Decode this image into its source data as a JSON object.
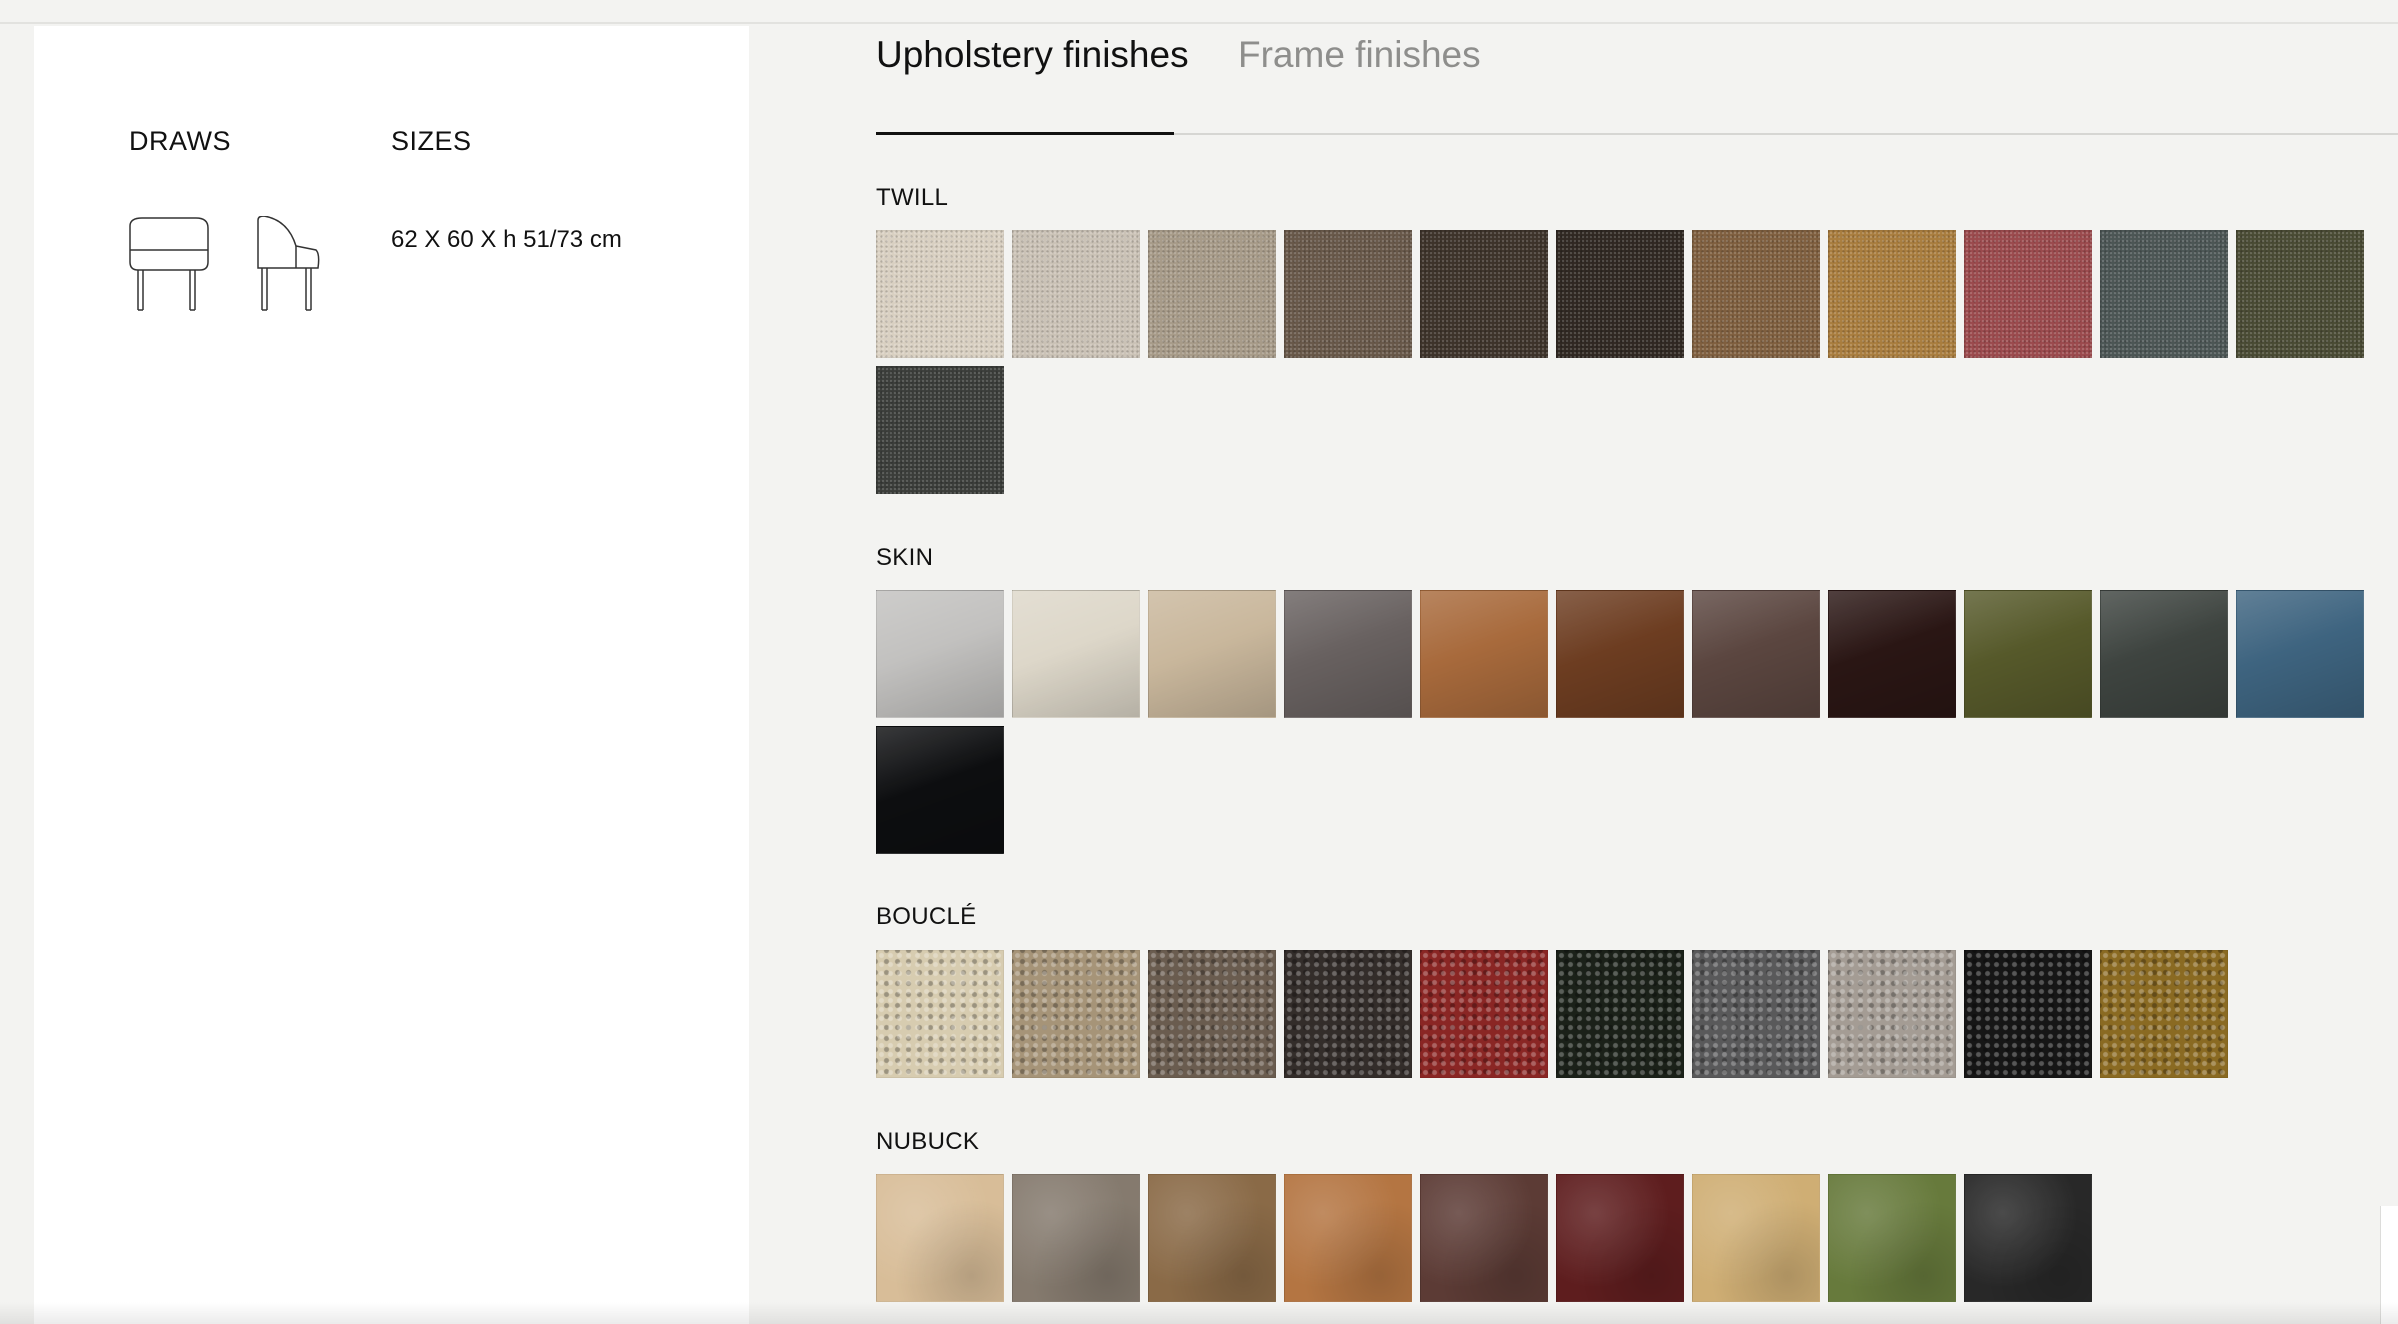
{
  "tabs": {
    "upholstery": "Upholstery finishes",
    "frame": "Frame finishes"
  },
  "info": {
    "draws_title": "DRAWS",
    "sizes_title": "SIZES",
    "sizes_value": "62 X 60 X h 51/73 cm",
    "drawings": [
      "chair-front-drawing",
      "chair-side-drawing"
    ]
  },
  "sections": [
    {
      "title": "TWILL",
      "texture": "twill",
      "colors": [
        "#d9d0c2",
        "#cac2b6",
        "#a79b89",
        "#685849",
        "#3d332a",
        "#302822",
        "#7f5f3f",
        "#a97d3e",
        "#9b4a4d",
        "#4c5655",
        "#4a4b34",
        "#3b3d3a"
      ]
    },
    {
      "title": "SKIN",
      "texture": "skin",
      "colors": [
        "#c2c1bf",
        "#ddd7c9",
        "#c9b79c",
        "#686160",
        "#a86a3c",
        "#6d3d21",
        "#5b4640",
        "#2a1614",
        "#56592a",
        "#3e4440",
        "#3e6480",
        "#0d0e10"
      ]
    },
    {
      "title": "BOUCLÉ",
      "texture": "boucle",
      "colors": [
        "#d7ccb0",
        "#a69478",
        "#6a5c4f",
        "#332d2a",
        "#8a2624",
        "#1b2119",
        "#59595a",
        "#a49c94",
        "#161616",
        "#8a6a22"
      ]
    },
    {
      "title": "NUBUCK",
      "texture": "nubuck",
      "colors": [
        "#d8bd98",
        "#857a6e",
        "#8a6a47",
        "#b47542",
        "#5c3b35",
        "#5e1d1e",
        "#cfae74",
        "#677a3c",
        "#282828"
      ]
    }
  ]
}
